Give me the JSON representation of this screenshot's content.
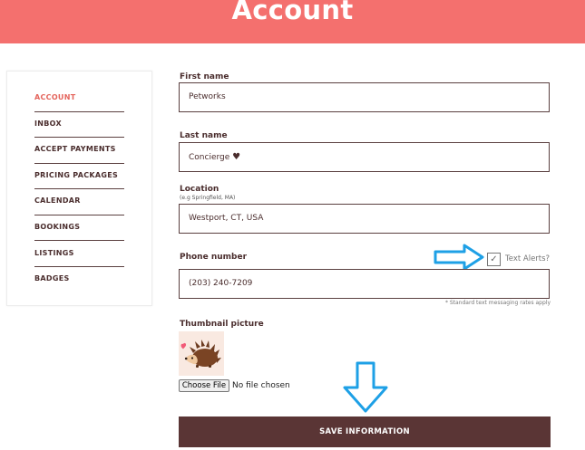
{
  "header": {
    "title": "Account"
  },
  "sidebar": {
    "items": [
      {
        "label": "ACCOUNT"
      },
      {
        "label": "INBOX"
      },
      {
        "label": "ACCEPT PAYMENTS"
      },
      {
        "label": "PRICING PACKAGES"
      },
      {
        "label": "CALENDAR"
      },
      {
        "label": "BOOKINGS"
      },
      {
        "label": "LISTINGS"
      },
      {
        "label": "BADGES"
      }
    ]
  },
  "form": {
    "first_name": {
      "label": "First name",
      "value": "Petworks"
    },
    "last_name": {
      "label": "Last name",
      "value": "Concierge",
      "suffix": "♥"
    },
    "location": {
      "label": "Location",
      "hint": "(e.g Springfield, MA)",
      "value": "Westport, CT, USA"
    },
    "phone": {
      "label": "Phone number",
      "value": "(203) 240-7209",
      "text_alerts_label": "Text Alerts?",
      "text_alerts_checked": true,
      "disclaimer": "* Standard text messaging rates apply"
    },
    "thumbnail": {
      "label": "Thumbnail picture",
      "choose_file_label": "Choose File",
      "file_status": "No file chosen"
    },
    "save_label": "SAVE INFORMATION"
  },
  "colors": {
    "header": "#f4706e",
    "active_nav": "#e4645c",
    "save_button": "#5a3535",
    "arrow": "#1ea0e6"
  }
}
